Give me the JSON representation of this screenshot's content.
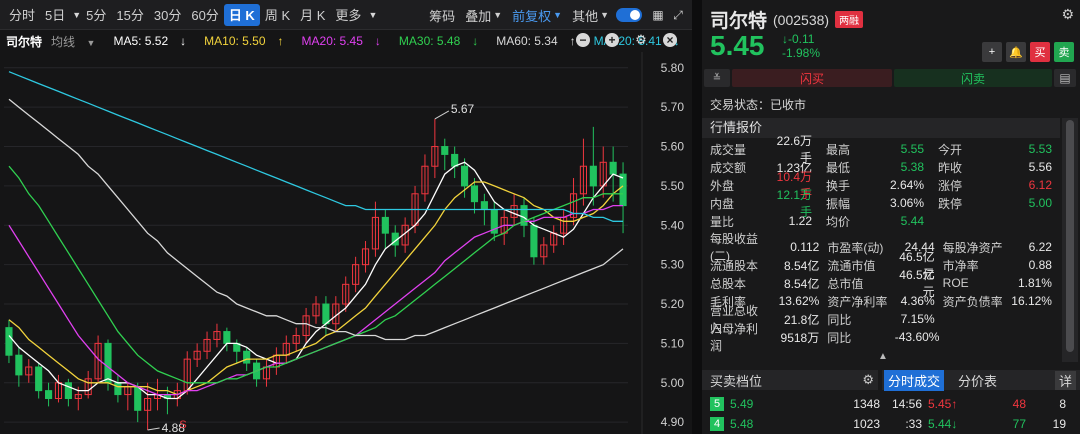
{
  "toolbar": {
    "periods": [
      "分时",
      "5日",
      "5分",
      "15分",
      "30分",
      "60分",
      "日 K",
      "周 K",
      "月 K",
      "更多"
    ],
    "active_period": "日 K",
    "right_items": {
      "chips": "筹码",
      "overlay": "叠加",
      "adjust": "前复权",
      "other": "其他"
    }
  },
  "ma_bar": {
    "name": "司尔特",
    "avg_line": "均线",
    "items": [
      {
        "label": "MA5: 5.52",
        "arrow": "↓",
        "color": "#ffffff"
      },
      {
        "label": "MA10: 5.50",
        "arrow": "↑",
        "color": "#f2d33c"
      },
      {
        "label": "MA20: 5.45",
        "arrow": "↓",
        "color": "#e040f0"
      },
      {
        "label": "MA30: 5.48",
        "arrow": "↓",
        "color": "#30d050"
      },
      {
        "label": "MA60: 5.34",
        "arrow": "↑",
        "color": "#d8d8d8"
      },
      {
        "label": "MA120: 5.41",
        "arrow": "↓",
        "color": "#2ec8e0"
      }
    ]
  },
  "chart_data": {
    "type": "candlestick",
    "y_ticks": [
      "5.80",
      "5.70",
      "5.60",
      "5.50",
      "5.40",
      "5.30",
      "5.20",
      "5.10",
      "5.00",
      "4.90"
    ],
    "ylim": [
      4.88,
      5.83
    ],
    "high_label": "5.67",
    "low_label": "4.88",
    "marker": "S",
    "candles": [
      [
        5.14,
        5.07,
        5.16,
        5.05
      ],
      [
        5.07,
        5.02,
        5.09,
        4.99
      ],
      [
        5.02,
        5.04,
        5.06,
        5.0
      ],
      [
        5.04,
        4.98,
        5.05,
        4.96
      ],
      [
        4.98,
        4.96,
        5.0,
        4.94
      ],
      [
        4.96,
        5.0,
        5.02,
        4.95
      ],
      [
        5.0,
        4.96,
        5.01,
        4.94
      ],
      [
        4.96,
        4.97,
        4.99,
        4.93
      ],
      [
        4.97,
        5.01,
        5.03,
        4.96
      ],
      [
        5.01,
        5.1,
        5.12,
        5.0
      ],
      [
        5.1,
        5.0,
        5.11,
        4.98
      ],
      [
        5.0,
        4.97,
        5.02,
        4.95
      ],
      [
        4.97,
        4.99,
        5.0,
        4.93
      ],
      [
        4.99,
        4.93,
        5.0,
        4.9
      ],
      [
        4.93,
        4.96,
        5.0,
        4.88
      ],
      [
        4.96,
        4.97,
        5.01,
        4.93
      ],
      [
        4.97,
        4.96,
        4.99,
        4.92
      ],
      [
        4.96,
        4.98,
        5.0,
        4.94
      ],
      [
        4.98,
        5.06,
        5.08,
        4.97
      ],
      [
        5.06,
        5.08,
        5.1,
        5.04
      ],
      [
        5.08,
        5.11,
        5.13,
        5.06
      ],
      [
        5.11,
        5.13,
        5.15,
        5.09
      ],
      [
        5.13,
        5.1,
        5.14,
        5.08
      ],
      [
        5.1,
        5.08,
        5.11,
        5.05
      ],
      [
        5.08,
        5.05,
        5.09,
        5.03
      ],
      [
        5.05,
        5.01,
        5.06,
        4.99
      ],
      [
        5.01,
        5.04,
        5.06,
        4.99
      ],
      [
        5.04,
        5.07,
        5.09,
        5.02
      ],
      [
        5.07,
        5.1,
        5.12,
        5.05
      ],
      [
        5.1,
        5.12,
        5.14,
        5.08
      ],
      [
        5.12,
        5.17,
        5.19,
        5.1
      ],
      [
        5.17,
        5.2,
        5.22,
        5.15
      ],
      [
        5.2,
        5.15,
        5.22,
        5.12
      ],
      [
        5.15,
        5.2,
        5.22,
        5.13
      ],
      [
        5.2,
        5.25,
        5.27,
        5.18
      ],
      [
        5.25,
        5.3,
        5.32,
        5.23
      ],
      [
        5.3,
        5.34,
        5.36,
        5.28
      ],
      [
        5.34,
        5.42,
        5.46,
        5.32
      ],
      [
        5.42,
        5.38,
        5.44,
        5.34
      ],
      [
        5.38,
        5.35,
        5.4,
        5.32
      ],
      [
        5.35,
        5.4,
        5.42,
        5.33
      ],
      [
        5.4,
        5.48,
        5.5,
        5.38
      ],
      [
        5.48,
        5.55,
        5.58,
        5.46
      ],
      [
        5.55,
        5.6,
        5.67,
        5.52
      ],
      [
        5.6,
        5.58,
        5.62,
        5.54
      ],
      [
        5.58,
        5.55,
        5.6,
        5.52
      ],
      [
        5.55,
        5.5,
        5.57,
        5.47
      ],
      [
        5.5,
        5.46,
        5.52,
        5.43
      ],
      [
        5.46,
        5.44,
        5.48,
        5.4
      ],
      [
        5.44,
        5.38,
        5.46,
        5.36
      ],
      [
        5.38,
        5.42,
        5.44,
        5.35
      ],
      [
        5.42,
        5.45,
        5.48,
        5.4
      ],
      [
        5.45,
        5.4,
        5.47,
        5.37
      ],
      [
        5.4,
        5.32,
        5.42,
        5.3
      ],
      [
        5.32,
        5.35,
        5.37,
        5.3
      ],
      [
        5.35,
        5.38,
        5.4,
        5.33
      ],
      [
        5.38,
        5.42,
        5.44,
        5.35
      ],
      [
        5.42,
        5.48,
        5.52,
        5.4
      ],
      [
        5.48,
        5.55,
        5.62,
        5.45
      ],
      [
        5.55,
        5.5,
        5.65,
        5.45
      ],
      [
        5.5,
        5.56,
        5.6,
        5.47
      ],
      [
        5.56,
        5.53,
        5.6,
        5.46
      ],
      [
        5.53,
        5.45,
        5.56,
        5.38
      ]
    ],
    "ma_lines": [
      {
        "name": "MA5",
        "color": "#ffffff",
        "values": [
          5.12,
          5.09,
          5.07,
          5.05,
          5.03,
          5.0,
          4.99,
          4.98,
          4.98,
          5.0,
          5.01,
          5.0,
          5.0,
          4.99,
          4.97,
          4.97,
          4.96,
          4.96,
          4.98,
          5.01,
          5.04,
          5.07,
          5.1,
          5.1,
          5.09,
          5.07,
          5.06,
          5.05,
          5.05,
          5.06,
          5.1,
          5.13,
          5.15,
          5.17,
          5.19,
          5.22,
          5.25,
          5.3,
          5.34,
          5.36,
          5.38,
          5.4,
          5.43,
          5.48,
          5.53,
          5.55,
          5.56,
          5.54,
          5.5,
          5.46,
          5.44,
          5.43,
          5.42,
          5.4,
          5.39,
          5.38,
          5.37,
          5.39,
          5.43,
          5.47,
          5.5,
          5.53,
          5.52
        ]
      },
      {
        "name": "MA10",
        "color": "#f2d33c",
        "values": [
          5.16,
          5.14,
          5.11,
          5.09,
          5.07,
          5.05,
          5.03,
          5.01,
          5.0,
          5.0,
          5.0,
          4.99,
          4.99,
          4.99,
          4.99,
          4.98,
          4.98,
          4.97,
          4.98,
          4.99,
          5.0,
          5.02,
          5.04,
          5.05,
          5.06,
          5.06,
          5.06,
          5.07,
          5.07,
          5.08,
          5.09,
          5.1,
          5.12,
          5.13,
          5.15,
          5.17,
          5.19,
          5.22,
          5.25,
          5.28,
          5.31,
          5.34,
          5.37,
          5.4,
          5.44,
          5.47,
          5.49,
          5.51,
          5.51,
          5.5,
          5.49,
          5.48,
          5.47,
          5.45,
          5.44,
          5.42,
          5.41,
          5.41,
          5.42,
          5.43,
          5.45,
          5.48,
          5.5
        ]
      },
      {
        "name": "MA20",
        "color": "#e040f0",
        "values": [
          5.4,
          5.36,
          5.32,
          5.28,
          5.24,
          5.2,
          5.16,
          5.12,
          5.09,
          5.06,
          5.04,
          5.02,
          5.0,
          4.99,
          4.98,
          4.97,
          4.97,
          4.97,
          4.98,
          4.98,
          4.99,
          5.0,
          5.01,
          5.02,
          5.02,
          5.03,
          5.04,
          5.05,
          5.05,
          5.06,
          5.07,
          5.08,
          5.09,
          5.1,
          5.11,
          5.12,
          5.14,
          5.16,
          5.18,
          5.2,
          5.22,
          5.24,
          5.26,
          5.28,
          5.31,
          5.33,
          5.35,
          5.37,
          5.38,
          5.39,
          5.4,
          5.4,
          5.41,
          5.41,
          5.42,
          5.42,
          5.42,
          5.43,
          5.43,
          5.44,
          5.44,
          5.45,
          5.45
        ]
      },
      {
        "name": "MA30",
        "color": "#30d050",
        "values": [
          5.55,
          5.52,
          5.48,
          5.45,
          5.41,
          5.37,
          5.33,
          5.29,
          5.25,
          5.21,
          5.17,
          5.13,
          5.1,
          5.07,
          5.05,
          5.03,
          5.02,
          5.01,
          5.0,
          5.0,
          5.0,
          5.0,
          5.01,
          5.01,
          5.02,
          5.03,
          5.04,
          5.04,
          5.05,
          5.06,
          5.07,
          5.08,
          5.09,
          5.1,
          5.11,
          5.12,
          5.13,
          5.14,
          5.16,
          5.17,
          5.19,
          5.21,
          5.23,
          5.25,
          5.27,
          5.29,
          5.31,
          5.33,
          5.35,
          5.37,
          5.38,
          5.4,
          5.41,
          5.42,
          5.43,
          5.44,
          5.45,
          5.46,
          5.47,
          5.47,
          5.48,
          5.48,
          5.48
        ]
      },
      {
        "name": "MA60",
        "color": "#d8d8d8",
        "values": [
          5.72,
          5.7,
          5.68,
          5.66,
          5.64,
          5.62,
          5.6,
          5.58,
          5.55,
          5.53,
          5.5,
          5.47,
          5.44,
          5.41,
          5.38,
          5.36,
          5.33,
          5.31,
          5.29,
          5.27,
          5.25,
          5.23,
          5.22,
          5.2,
          5.19,
          5.18,
          5.17,
          5.17,
          5.16,
          5.15,
          5.15,
          5.14,
          5.14,
          5.13,
          5.13,
          5.12,
          5.12,
          5.12,
          5.11,
          5.11,
          5.11,
          5.12,
          5.12,
          5.13,
          5.14,
          5.15,
          5.16,
          5.17,
          5.18,
          5.19,
          5.2,
          5.21,
          5.22,
          5.23,
          5.24,
          5.25,
          5.26,
          5.27,
          5.28,
          5.29,
          5.3,
          5.32,
          5.34
        ]
      },
      {
        "name": "MA120",
        "color": "#2ec8e0",
        "values": [
          5.79,
          5.78,
          5.77,
          5.76,
          5.75,
          5.74,
          5.73,
          5.72,
          5.71,
          5.7,
          5.69,
          5.68,
          5.67,
          5.66,
          5.65,
          5.64,
          5.63,
          5.62,
          5.61,
          5.6,
          5.59,
          5.58,
          5.57,
          5.56,
          5.55,
          5.54,
          5.53,
          5.52,
          5.51,
          5.5,
          5.49,
          5.48,
          5.47,
          5.46,
          5.45,
          5.45,
          5.44,
          5.44,
          5.44,
          5.44,
          5.44,
          5.44,
          5.44,
          5.44,
          5.44,
          5.44,
          5.44,
          5.44,
          5.44,
          5.44,
          5.44,
          5.44,
          5.44,
          5.44,
          5.44,
          5.44,
          5.44,
          5.43,
          5.43,
          5.42,
          5.42,
          5.41,
          5.41
        ]
      }
    ]
  },
  "quote": {
    "name": "司尔特",
    "code": "(002538)",
    "tag": "两融",
    "price": "5.45",
    "change": "↓-0.11",
    "change_pct": "-1.98%",
    "flash_buy": "闪买",
    "flash_sell": "闪卖",
    "buy": "买",
    "sell": "卖",
    "status": "交易状态：已收市",
    "section": "行情报价"
  },
  "stats": [
    [
      "成交量",
      "22.6万手",
      "最高",
      "5.55",
      "今开",
      "5.53"
    ],
    [
      "成交额",
      "1.23亿",
      "最低",
      "5.38",
      "昨收",
      "5.56"
    ],
    [
      "外盘",
      "10.4万手",
      "换手",
      "2.64%",
      "涨停",
      "6.12"
    ],
    [
      "内盘",
      "12.1万手",
      "振幅",
      "3.06%",
      "跌停",
      "5.00"
    ],
    [
      "量比",
      "1.22",
      "均价",
      "5.44",
      "",
      ""
    ]
  ],
  "fundamentals": [
    [
      "每股收益(二)",
      "0.112",
      "市盈率(动)",
      "24.44",
      "每股净资产",
      "6.22"
    ],
    [
      "流通股本",
      "8.54亿",
      "流通市值",
      "46.5亿元",
      "市净率",
      "0.88"
    ],
    [
      "总股本",
      "8.54亿",
      "总市值",
      "46.5亿元",
      "ROE",
      "1.81%"
    ],
    [
      "毛利率",
      "13.62%",
      "资产净利率",
      "4.36%",
      "资产负债率",
      "16.12%"
    ],
    [
      "营业总收入",
      "21.8亿",
      "同比",
      "7.15%",
      "",
      ""
    ],
    [
      "归母净利润",
      "9518万",
      "同比",
      "-43.60%",
      "",
      ""
    ]
  ],
  "bottom": {
    "orderbook_title": "买卖档位",
    "ticks_tab": "分时成交",
    "price_tab": "分价表",
    "detail": "详",
    "orders": [
      {
        "level": "5",
        "price": "5.49",
        "vol": "1348"
      },
      {
        "level": "4",
        "price": "5.48",
        "vol": "1023"
      }
    ],
    "ticks": [
      {
        "time": "14:56",
        "price": "5.45↑",
        "vol": "48",
        "n": "8"
      },
      {
        "time": ":33",
        "price": "5.44↓",
        "vol": "77",
        "n": "19"
      }
    ]
  }
}
